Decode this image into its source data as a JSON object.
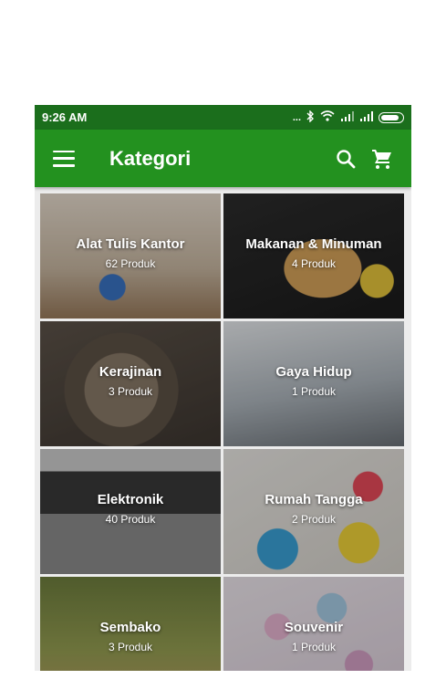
{
  "status_bar": {
    "time": "9:26 AM",
    "signal_text": "..."
  },
  "app_bar": {
    "title": "Kategori"
  },
  "categories": [
    {
      "name": "Alat Tulis Kantor",
      "count": "62 Produk"
    },
    {
      "name": "Makanan & Minuman",
      "count": "4 Produk"
    },
    {
      "name": "Kerajinan",
      "count": "3 Produk"
    },
    {
      "name": "Gaya Hidup",
      "count": "1 Produk"
    },
    {
      "name": "Elektronik",
      "count": "40 Produk"
    },
    {
      "name": "Rumah Tangga",
      "count": "2 Produk"
    },
    {
      "name": "Sembako",
      "count": "3 Produk"
    },
    {
      "name": "Souvenir",
      "count": "1 Produk"
    }
  ],
  "colors": {
    "status_bar": "#1b6e1c",
    "app_bar": "#23911f"
  },
  "icons": [
    "menu-icon",
    "search-icon",
    "cart-icon",
    "bluetooth-icon",
    "wifi-icon",
    "signal-icon",
    "battery-icon"
  ]
}
